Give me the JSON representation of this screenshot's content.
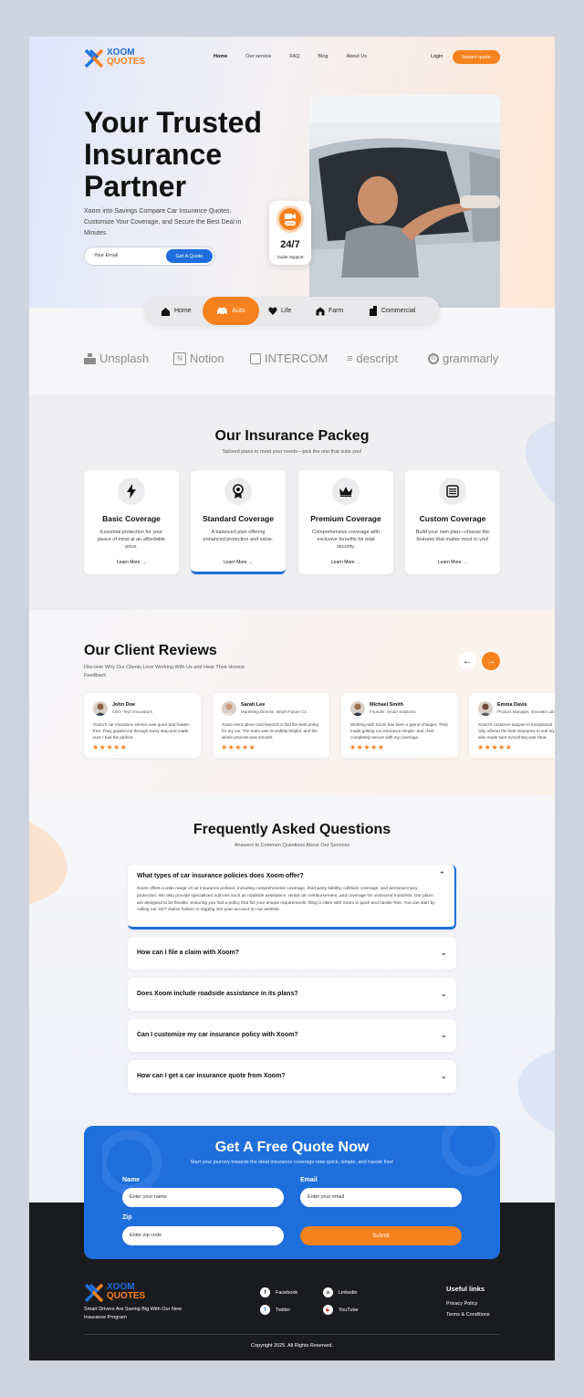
{
  "brand": {
    "line1": "XOOM",
    "line2": "QUOTES"
  },
  "nav": {
    "items": [
      "Home",
      "Our service",
      "FAQ",
      "Blog",
      "About Us"
    ],
    "login": "Login",
    "cta": "Instant quote"
  },
  "hero": {
    "title_lines": [
      "Your Trusted",
      "Insurance",
      "Partner"
    ],
    "subtitle": "Xoom into Savings Compare Car Insurance Quotes, Customize Your Coverage, and Secure the Best Deal in Minutes",
    "email_placeholder": "Your Email",
    "get_quote": "Get A Quote",
    "support_badge": "LIVE",
    "support_value": "24/7",
    "support_label": "Guide Support"
  },
  "tabs": [
    "Home",
    "Auto",
    "Life",
    "Farm",
    "Commercial"
  ],
  "brands": [
    "Unsplash",
    "Notion",
    "INTERCOM",
    "descript",
    "grammarly"
  ],
  "packages": {
    "title": "Our Insurance Packeg",
    "subtitle": "Tailored plans to meet your needs—pick the one that suits you!",
    "cards": [
      {
        "title": "Basic Coverage",
        "desc": "Essential protection for your peace of mind at an affordable price.",
        "more": "Learn More →",
        "icon": "bolt-icon"
      },
      {
        "title": "Standard Coverage",
        "desc": "A balanced plan offering enhanced protection and value.",
        "more": "Learn More →",
        "icon": "badge-icon"
      },
      {
        "title": "Premium Coverage",
        "desc": "Comprehensive coverage with exclusive benefits for total security.",
        "more": "Learn More →",
        "icon": "crown-icon"
      },
      {
        "title": "Custom Coverage",
        "desc": "Build your own plan—choose the features that matter most to you!",
        "more": "Learn More →",
        "icon": "sliders-icon"
      }
    ]
  },
  "reviews": {
    "title": "Our Client Reviews",
    "subtitle": "Discover Why Our Clients Love Working With Us and Hear Their Honest Feedback",
    "prev": "←",
    "next": "→",
    "items": [
      {
        "name": "John Doe",
        "role": "CEO, Tech Innovators",
        "text": "Xoom's car insurance service was quick and hassle-free. They guided me through every step and made sure I had the perfect.",
        "stars": "★★★★★"
      },
      {
        "name": "Sarah Lee",
        "role": "Marketing Director, Bright Future Co",
        "text": "Xoom went above and beyond to find the best policy for my car. The team was incredibly helpful, and the whole process was smooth.",
        "stars": "★★★★★"
      },
      {
        "name": "Michael Smith",
        "role": "Founder, Smart Solutions",
        "text": "Working with Xoom has been a game-changer. They made getting car insurance simple, and I feel completely secure with my coverage.",
        "stars": "★★★★★"
      },
      {
        "name": "Emma Davis",
        "role": "Product Manager, Innovate Labs",
        "text": "Xoom's customer support is exceptional. They not only offered the best insurance to suit my needs but also made sure everything was clear.",
        "stars": "★★★★★"
      }
    ]
  },
  "faq": {
    "title": "Frequently Asked Questions",
    "subtitle": "Answers to Common Questions About Our Services",
    "items": [
      {
        "q": "What types of car insurance policies does Xoom offer?",
        "a": "Xoom offers a wide range of car insurance policies, including comprehensive coverage, third-party liability, collision coverage, and personal injury protection. We also provide specialized add-ons such as roadside assistance, rental car reimbursement, and coverage for uninsured motorists. Our plans are designed to be flexible, ensuring you find a policy that fits your unique requirements. filing a claim with Xoom is quick and hassle-free. You can start by calling our 24/7 claims hotline or logging into your account on our website."
      },
      {
        "q": "How can I file a claim with Xoom?"
      },
      {
        "q": "Does Xoom include roadside assistance in its plans?"
      },
      {
        "q": "Can I customize my car insurance policy with Xoom?"
      },
      {
        "q": "How can I get a car insurance quote from Xoom?"
      }
    ]
  },
  "quote": {
    "title": "Get A Free Quote Now",
    "subtitle": "Start your journey towards the ideal insurance coverage now quick, simple, and hassle free!",
    "name_label": "Name",
    "name_placeholder": "Enter your name",
    "email_label": "Email",
    "email_placeholder": "Enter your email",
    "zip_label": "Zip",
    "zip_placeholder": "Enter zip code",
    "submit": "Submit"
  },
  "footer": {
    "tagline": "Smart Drivers Are Saving Big With Our New Insurance Program",
    "social": [
      {
        "label": "Facebook",
        "glyph": "f"
      },
      {
        "label": "Linkedin",
        "glyph": "in"
      },
      {
        "label": "Twitter",
        "glyph": "t"
      },
      {
        "label": "YouTube",
        "glyph": "▶"
      }
    ],
    "links_title": "Useful links",
    "links": [
      "Privacy Policy",
      "Terms & Conditions"
    ],
    "copyright": "Copyright 2025. All Rights Reserved."
  },
  "colors": {
    "primary": "#1e6fdc",
    "accent": "#f5821f",
    "footer": "#1a1b1f"
  }
}
